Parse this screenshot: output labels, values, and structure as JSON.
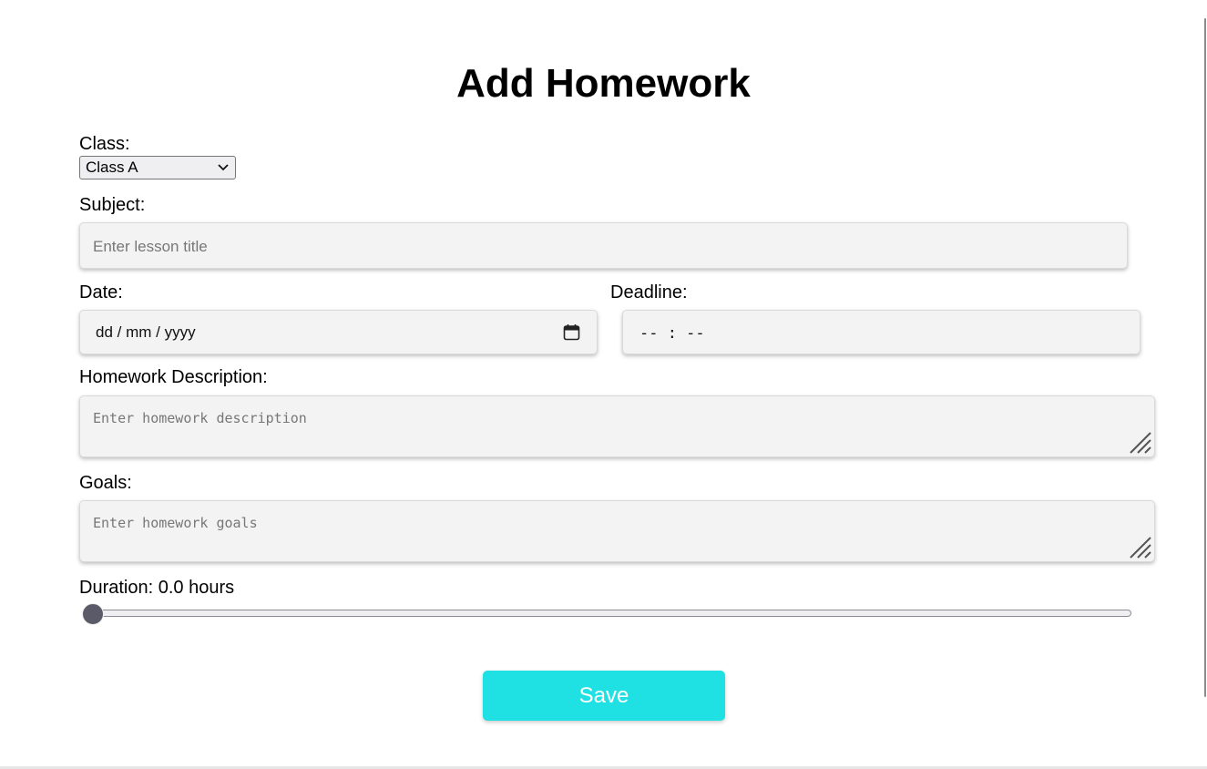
{
  "page": {
    "title": "Add Homework"
  },
  "form": {
    "class_label": "Class:",
    "class_selected": "Class A",
    "subject_label": "Subject:",
    "subject_placeholder": "Enter lesson title",
    "date_label": "Date:",
    "date_placeholder": "dd / mm / yyyy",
    "deadline_label": "Deadline:",
    "deadline_placeholder": "-- : --",
    "description_label": "Homework Description:",
    "description_placeholder": "Enter homework description",
    "goals_label": "Goals:",
    "goals_placeholder": "Enter homework goals",
    "duration_label": "Duration: 0.0 hours",
    "duration_value": 0.0,
    "save_label": "Save"
  },
  "icons": {
    "calendar": "calendar-icon",
    "chevron": "chevron-down-icon",
    "resize": "resize-handle-icon"
  },
  "colors": {
    "save_button": "#1fe0e3",
    "field_background": "#f3f3f3",
    "slider_thumb": "#5a5a68"
  }
}
